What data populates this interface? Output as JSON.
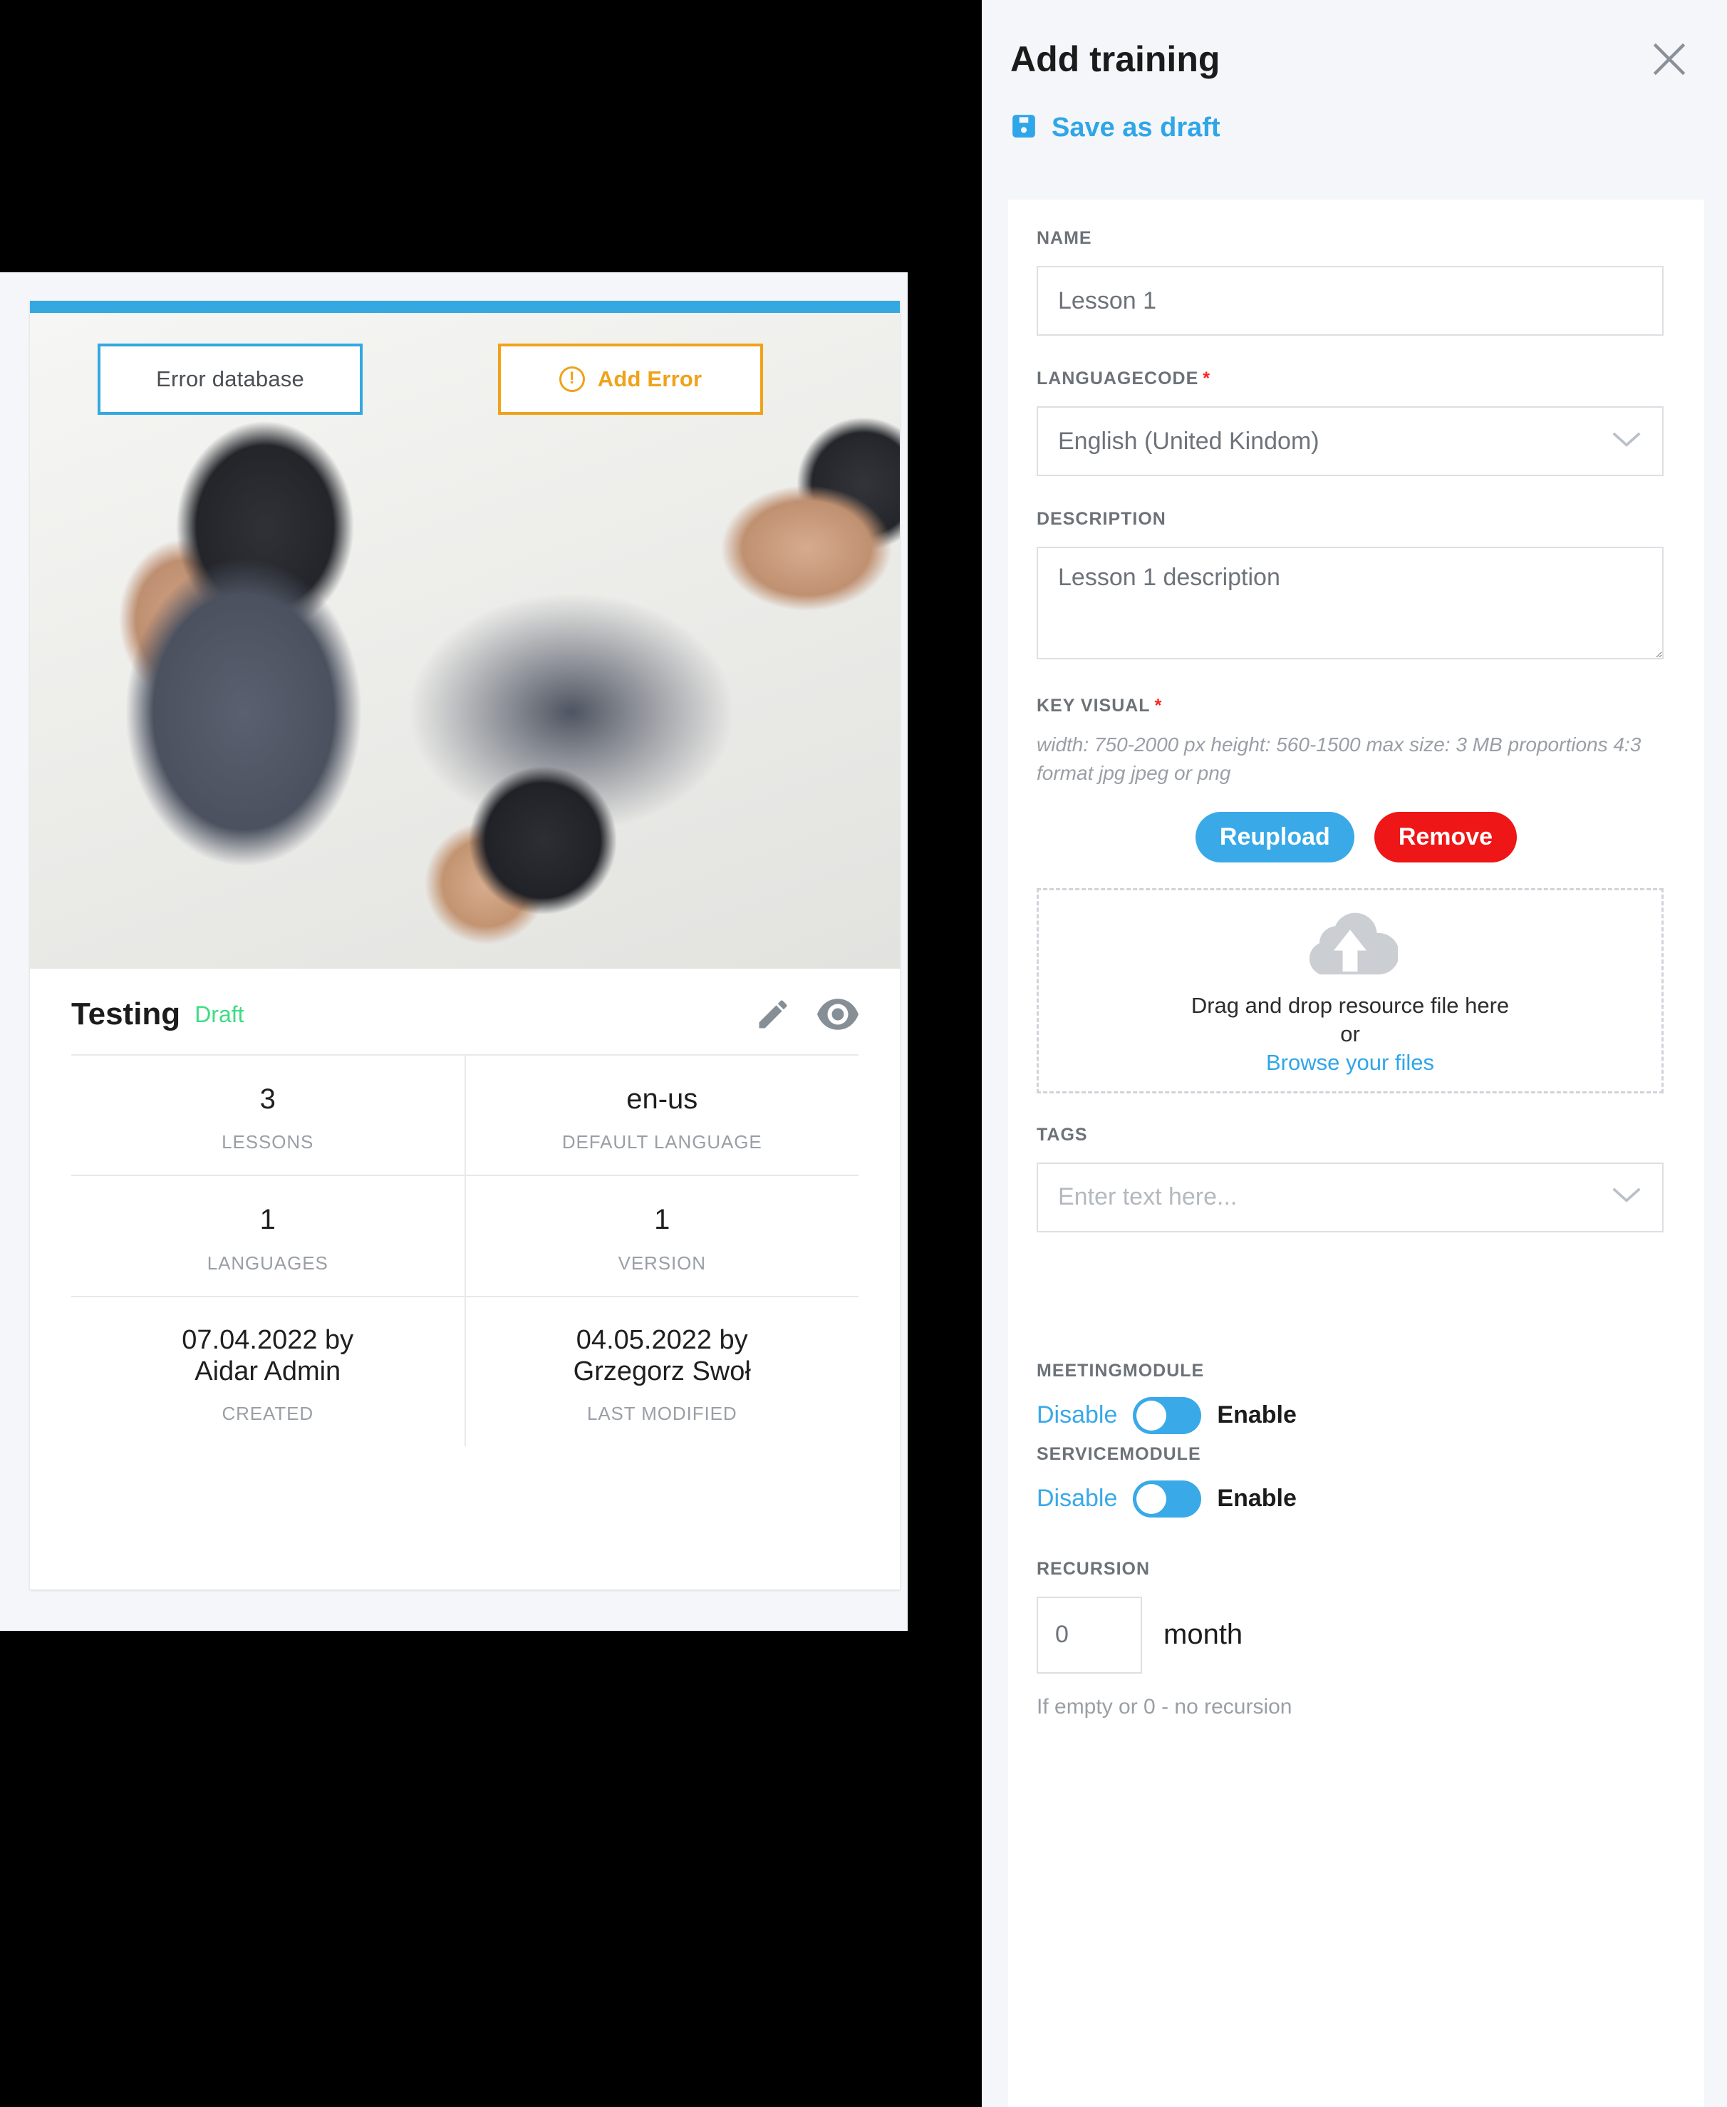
{
  "left_viewport": {
    "card": {
      "overlay_buttons": [
        {
          "name": "error-database",
          "label": "Error database"
        },
        {
          "name": "add-error",
          "label": "Add Error",
          "icon": "warning-circle-icon"
        }
      ],
      "title": "Testing",
      "status_badge": "Draft",
      "title_actions": [
        {
          "name": "edit",
          "icon": "pencil-icon"
        },
        {
          "name": "preview",
          "icon": "eye-icon"
        }
      ],
      "stats": [
        [
          {
            "value": "3",
            "label": "LESSONS"
          },
          {
            "value": "en-us",
            "label": "DEFAULT LANGUAGE"
          }
        ],
        [
          {
            "value": "1",
            "label": "LANGUAGES"
          },
          {
            "value": "1",
            "label": "VERSION"
          }
        ],
        [
          {
            "value": "07.04.2022 by\nAidar Admin",
            "label": "CREATED"
          },
          {
            "value": "04.05.2022 by\nGrzegorz Swoł",
            "label": "LAST MODIFIED"
          }
        ]
      ]
    }
  },
  "side_panel": {
    "title": "Add training",
    "close_icon": "close-icon",
    "save_draft": {
      "label": "Save as draft",
      "icon": "save-floppy-icon"
    },
    "form": {
      "name": {
        "label": "NAME",
        "value": "Lesson 1",
        "placeholder": "Lesson 1"
      },
      "languagecode": {
        "label": "LANGUAGECODE",
        "required": "*",
        "value": "English (United Kindom)",
        "chevron": "chevron-down-icon"
      },
      "description": {
        "label": "DESCRIPTION",
        "value": "Lesson 1 description",
        "placeholder": "Lesson 1 description"
      },
      "key_visual": {
        "label": "KEY VISUAL",
        "required": "*",
        "hint": "width: 750-2000 px height: 560-1500 max size: 3 MB proportions 4:3 format jpg jpeg or png",
        "reupload_label": "Reupload",
        "remove_label": "Remove",
        "dropzone": {
          "icon": "upload-cloud-icon",
          "line1": "Drag and drop resource file here",
          "line2": "or",
          "browse_label": "Browse your files"
        }
      },
      "tags": {
        "label": "TAGS",
        "placeholder": "Enter text here...",
        "chevron": "chevron-down-icon"
      },
      "meetingmodule": {
        "label": "MEETINGMODULE",
        "off_label": "Disable",
        "on_label": "Enable"
      },
      "servicemodule": {
        "label": "SERVICEMODULE",
        "off_label": "Disable",
        "on_label": "Enable"
      },
      "recursion": {
        "label": "RECURSION",
        "value": "0",
        "unit": "month",
        "hint": "If empty or 0 - no recursion"
      }
    }
  },
  "colors": {
    "accent_blue": "#34a8e0",
    "link_blue": "#2fa6e8",
    "warn_orange": "#f0a21a",
    "danger_red": "#ee1616",
    "draft_green": "#3ddc84",
    "required_red": "#ff2020",
    "panel_bg": "#f4f6f9"
  }
}
